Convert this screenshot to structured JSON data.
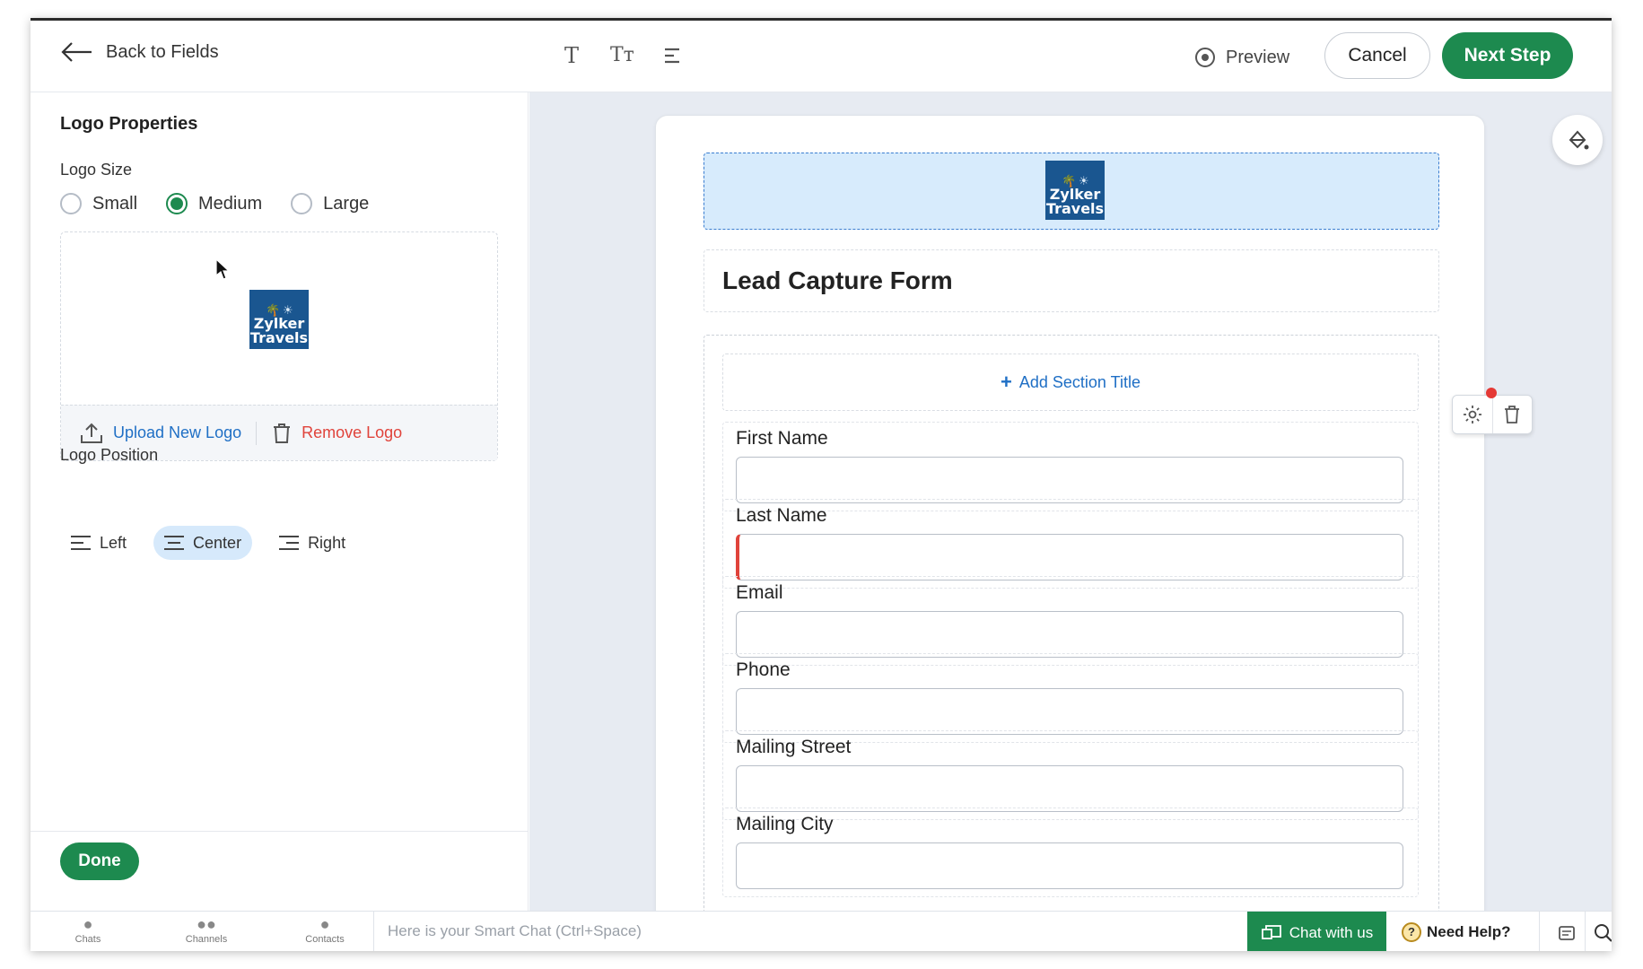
{
  "header": {
    "back_label": "Back to Fields",
    "preview_label": "Preview",
    "cancel_label": "Cancel",
    "next_label": "Next Step",
    "format_tools": [
      "text-icon",
      "text-size-icon",
      "align-icon"
    ]
  },
  "left_panel": {
    "title": "Logo Properties",
    "size_label": "Logo Size",
    "sizes": [
      {
        "label": "Small",
        "selected": false
      },
      {
        "label": "Medium",
        "selected": true
      },
      {
        "label": "Large",
        "selected": false
      }
    ],
    "logo": {
      "line1": "Zylker",
      "line2": "Travels"
    },
    "upload_label": "Upload New Logo",
    "remove_label": "Remove Logo",
    "position_label": "Logo Position",
    "positions": [
      {
        "label": "Left",
        "selected": false
      },
      {
        "label": "Center",
        "selected": true
      },
      {
        "label": "Right",
        "selected": false
      }
    ],
    "done_label": "Done"
  },
  "form": {
    "title": "Lead Capture Form",
    "add_section_label": "Add Section Title",
    "fields": [
      {
        "label": "First Name",
        "error": false
      },
      {
        "label": "Last Name",
        "error": true
      },
      {
        "label": "Email",
        "error": false
      },
      {
        "label": "Phone",
        "error": false
      },
      {
        "label": "Mailing Street",
        "error": false
      },
      {
        "label": "Mailing City",
        "error": false
      }
    ]
  },
  "bottom_bar": {
    "chats": "Chats",
    "channels": "Channels",
    "contacts": "Contacts",
    "smart_chat_placeholder": "Here is your Smart Chat (Ctrl+Space)",
    "chat_with_us": "Chat with us",
    "need_help": "Need Help?"
  },
  "colors": {
    "accent_green": "#1d8a4f",
    "link_blue": "#1f6fc5",
    "danger_red": "#e0433b",
    "logo_blue": "#1a5690",
    "canvas_bg": "#e7ebf2"
  }
}
